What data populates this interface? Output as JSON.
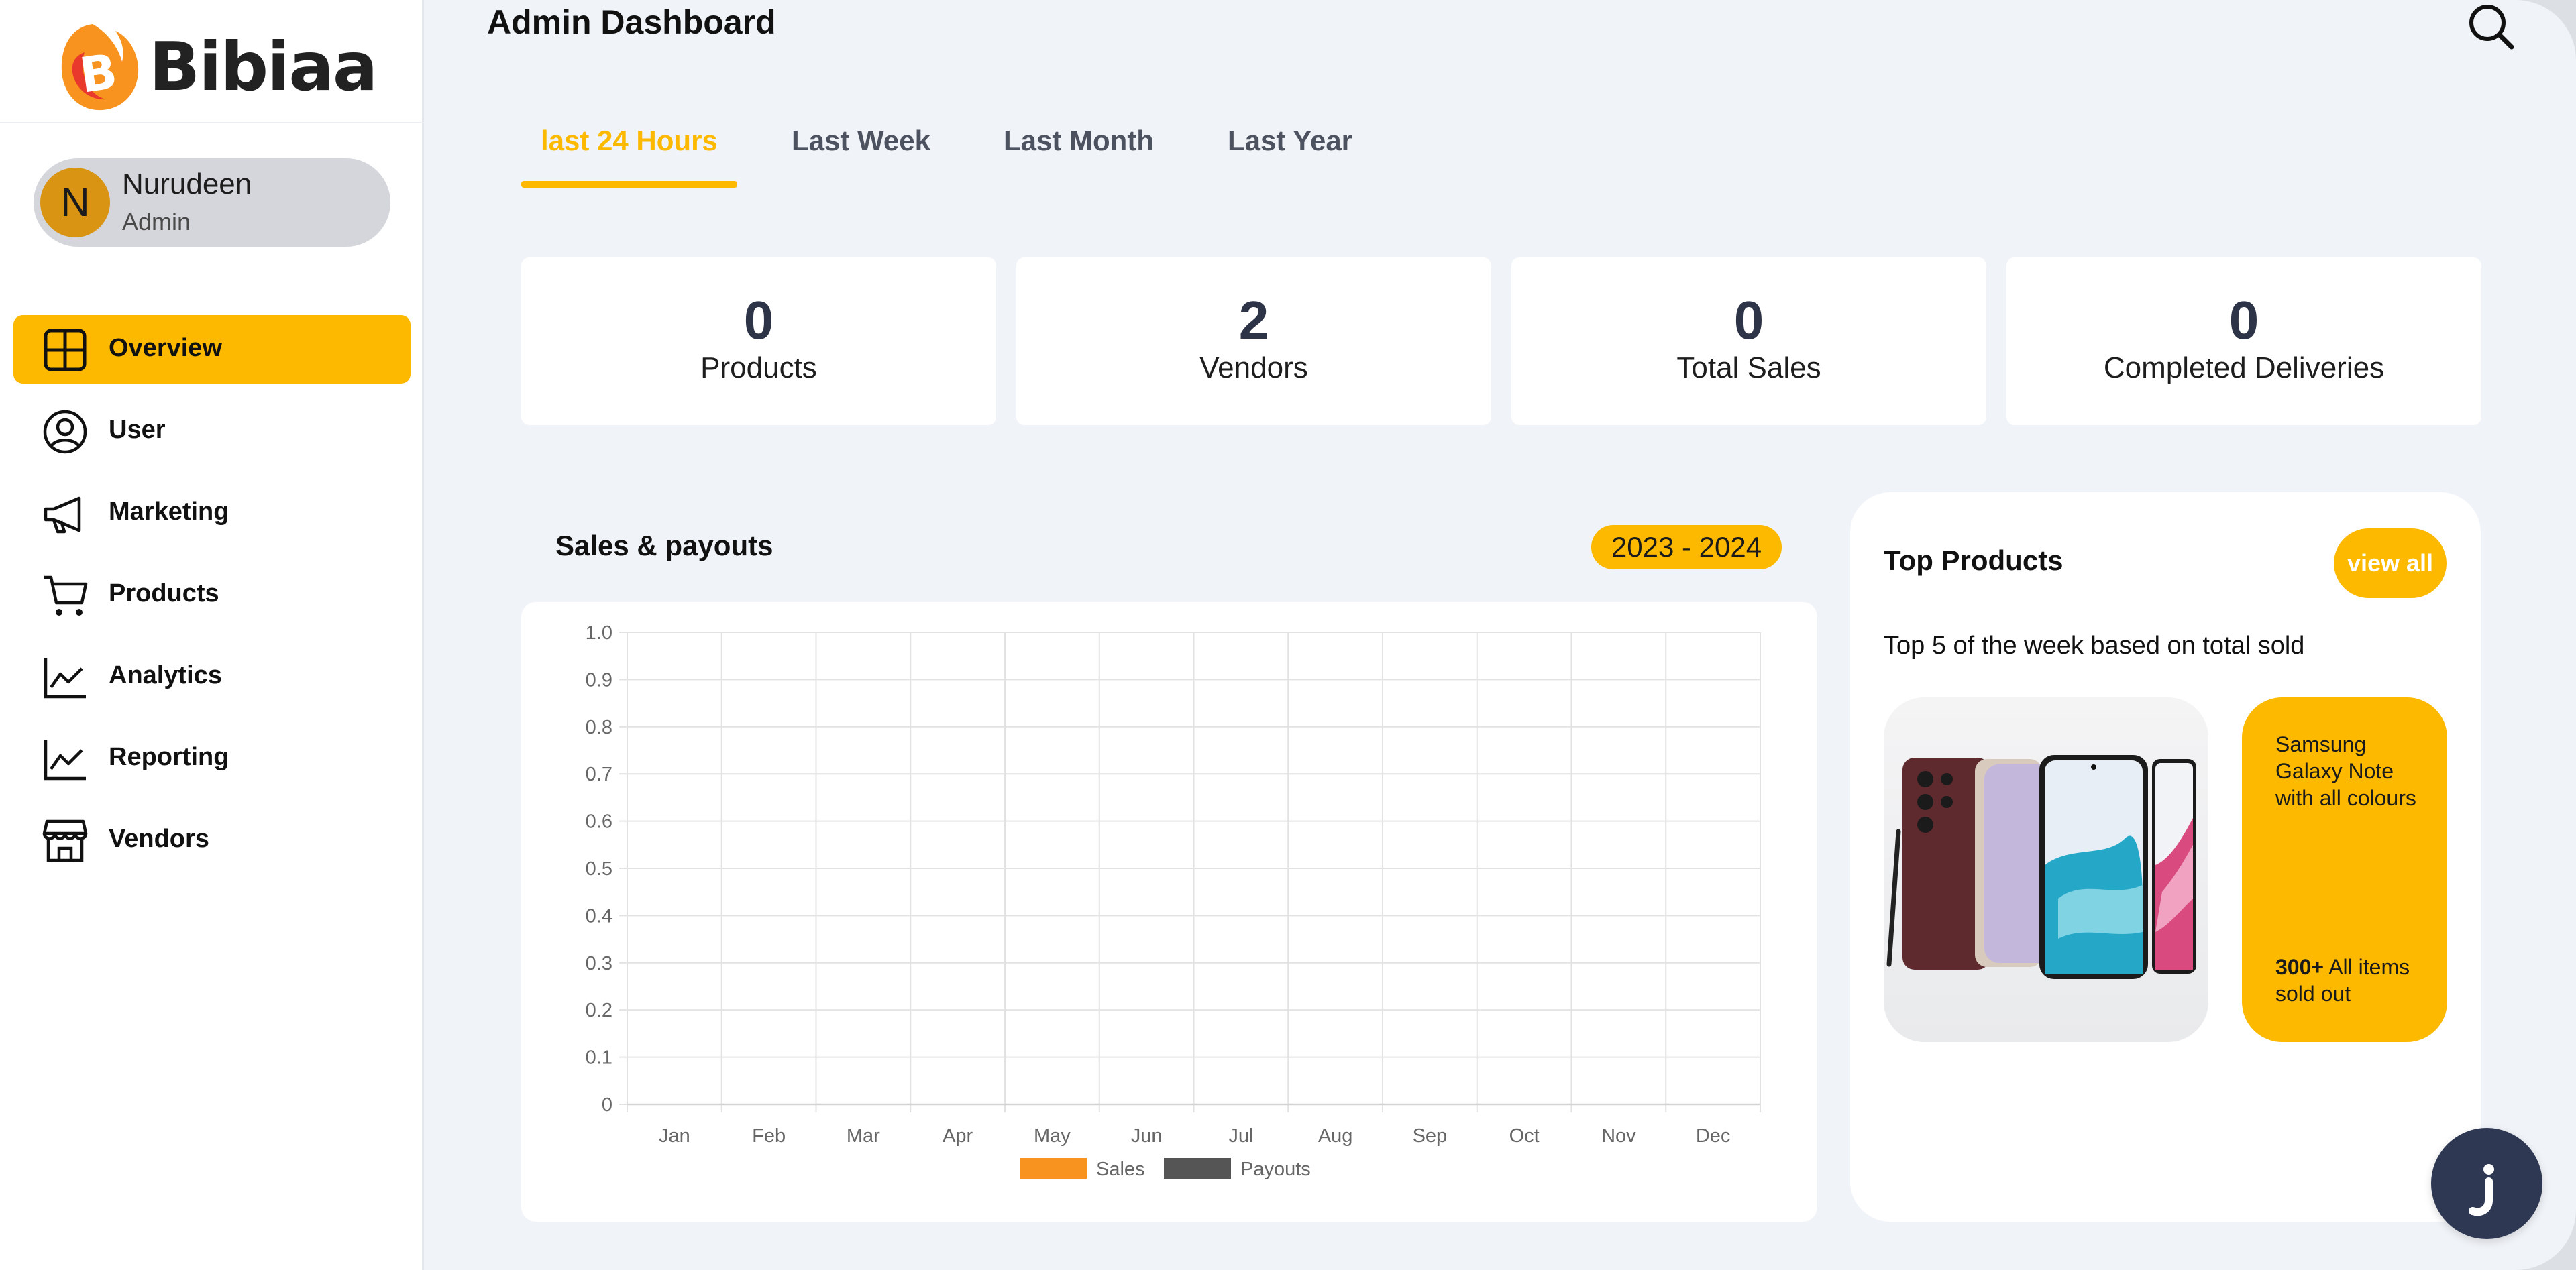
{
  "brand": {
    "name": "Bibiaa",
    "accent": "#fcb900",
    "logo_color": "#f7931e"
  },
  "user": {
    "initial": "N",
    "name": "Nurudeen",
    "role": "Admin"
  },
  "sidebar": {
    "items": [
      {
        "label": "Overview",
        "icon": "grid-icon",
        "active": true
      },
      {
        "label": "User",
        "icon": "user-circle-icon"
      },
      {
        "label": "Marketing",
        "icon": "megaphone-icon"
      },
      {
        "label": "Products",
        "icon": "cart-icon"
      },
      {
        "label": "Analytics",
        "icon": "line-chart-icon"
      },
      {
        "label": "Reporting",
        "icon": "line-chart-icon"
      },
      {
        "label": "Vendors",
        "icon": "store-icon"
      }
    ]
  },
  "header": {
    "title": "Admin Dashboard",
    "search_icon": "search-icon"
  },
  "tabs": [
    {
      "label": "last 24 Hours",
      "active": true
    },
    {
      "label": "Last Week"
    },
    {
      "label": "Last Month"
    },
    {
      "label": "Last Year"
    }
  ],
  "stats": [
    {
      "value": "0",
      "label": "Products"
    },
    {
      "value": "2",
      "label": "Vendors"
    },
    {
      "value": "0",
      "label": "Total Sales"
    },
    {
      "value": "0",
      "label": "Completed Deliveries"
    }
  ],
  "sales": {
    "title": "Sales & payouts",
    "year_range": "2023 - 2024"
  },
  "chart_data": {
    "type": "bar",
    "title": "",
    "xlabel": "",
    "ylabel": "",
    "categories": [
      "Jan",
      "Feb",
      "Mar",
      "Apr",
      "May",
      "Jun",
      "Jul",
      "Aug",
      "Sep",
      "Oct",
      "Nov",
      "Dec"
    ],
    "series": [
      {
        "name": "Sales",
        "color": "#f7931e",
        "values": [
          0,
          0,
          0,
          0,
          0,
          0,
          0,
          0,
          0,
          0,
          0,
          0
        ]
      },
      {
        "name": "Payouts",
        "color": "#555555",
        "values": [
          0,
          0,
          0,
          0,
          0,
          0,
          0,
          0,
          0,
          0,
          0,
          0
        ]
      }
    ],
    "ylim": [
      0,
      1.0
    ],
    "yticks": [
      "0",
      "0.1",
      "0.2",
      "0.3",
      "0.4",
      "0.5",
      "0.6",
      "0.7",
      "0.8",
      "0.9",
      "1.0"
    ],
    "grid": true,
    "legend": "bottom"
  },
  "top_products": {
    "title": "Top Products",
    "view_all_label": "view all",
    "subtitle": "Top 5 of the week based on total sold",
    "product": {
      "name": "Samsung Galaxy Note with all colours",
      "sold_count": "300+",
      "sold_text": "All items sold out"
    }
  },
  "chat": {
    "icon": "chat-icon"
  }
}
